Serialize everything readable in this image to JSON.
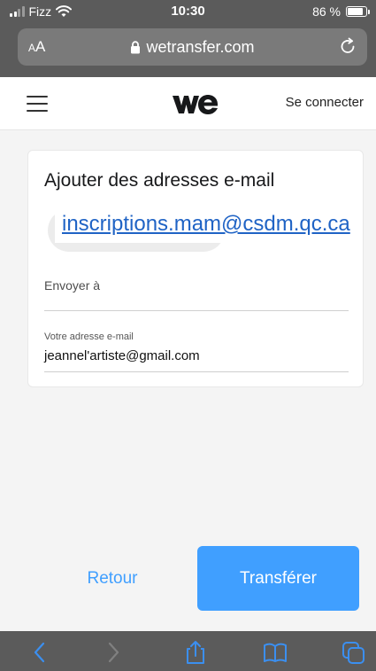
{
  "status_bar": {
    "carrier": "Fizz",
    "time": "10:30",
    "battery_text": "86 %",
    "battery_level": 0.86
  },
  "browser": {
    "text_size_label_small": "A",
    "text_size_label_large": "A",
    "url": "wetransfer.com"
  },
  "header": {
    "login_label": "Se connecter"
  },
  "card": {
    "title": "Ajouter des adresses e-mail",
    "recipient_email": "inscriptions.mam@csdm.qc.ca",
    "send_to_label": "Envoyer à",
    "your_email_label": "Votre adresse e-mail",
    "your_email_value": "jeannel'artiste@gmail.com"
  },
  "actions": {
    "back_label": "Retour",
    "transfer_label": "Transférer"
  },
  "colors": {
    "accent": "#409fff",
    "safari_bar": "#5b5b5b",
    "link": "#1f63c5"
  }
}
